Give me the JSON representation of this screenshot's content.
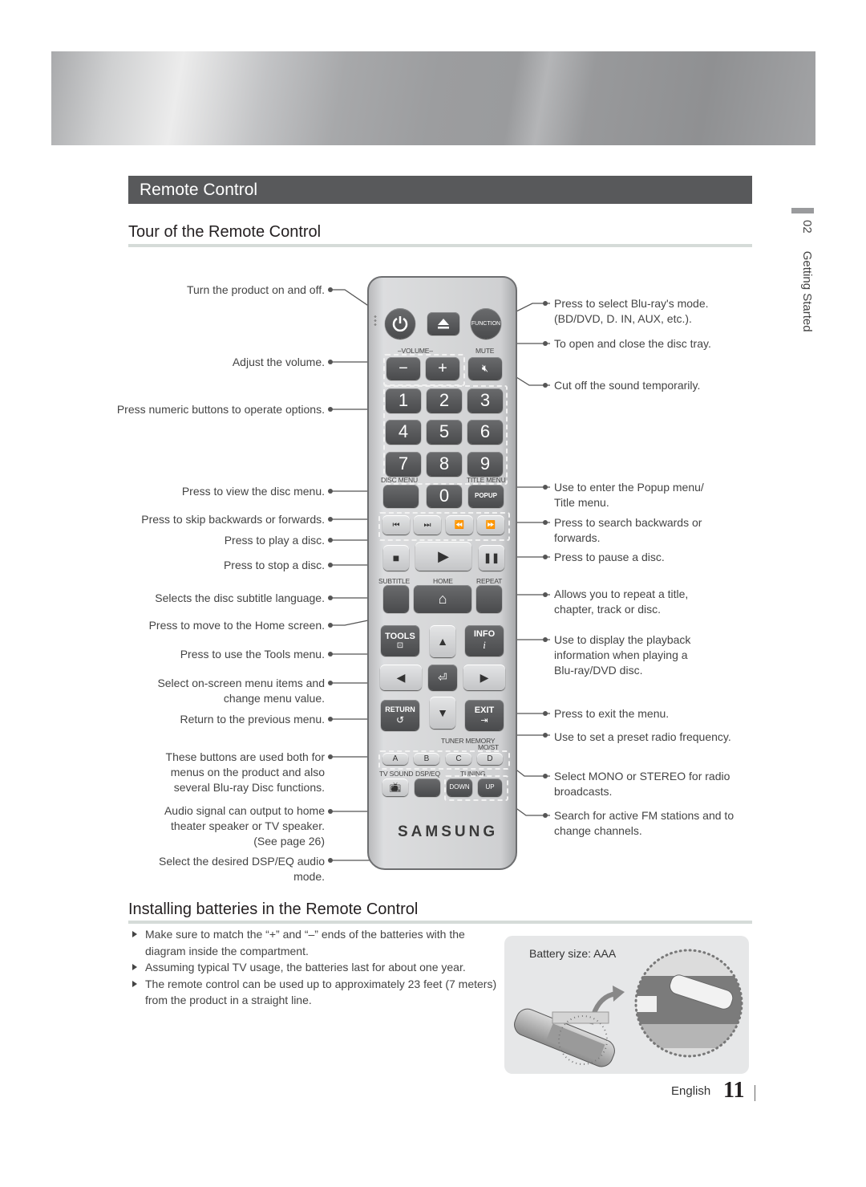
{
  "section_title": "Remote Control",
  "tour_heading": "Tour of the Remote Control",
  "side_tab": {
    "number": "02",
    "label": "Getting Started"
  },
  "left_callouts": [
    {
      "text": "Turn the product on and off."
    },
    {
      "text": "Adjust the volume."
    },
    {
      "text": "Press numeric buttons to operate options."
    },
    {
      "text": "Press to view the disc menu."
    },
    {
      "text": "Press to skip backwards or forwards."
    },
    {
      "text": "Press to play a disc."
    },
    {
      "text": "Press to stop a disc."
    },
    {
      "text": "Selects the disc subtitle language."
    },
    {
      "text": "Press to move to the Home screen."
    },
    {
      "text": "Press to use the Tools menu."
    },
    {
      "text": "Select on-screen menu items and change menu value."
    },
    {
      "text": "Return to the previous menu."
    },
    {
      "text": "These buttons are used both for menus on the product and also several Blu-ray Disc functions."
    },
    {
      "text": "Audio signal can output to home theater speaker or TV speaker. (See page 26)"
    },
    {
      "text": "Select the desired DSP/EQ audio mode."
    }
  ],
  "right_callouts": [
    {
      "text": "Press to select Blu-ray's mode. (BD/DVD, D. IN, AUX, etc.)."
    },
    {
      "text": "To open and close the disc tray."
    },
    {
      "text": "Cut off the sound temporarily."
    },
    {
      "text": "Use to enter the Popup menu/ Title menu."
    },
    {
      "text": "Press to search backwards or forwards."
    },
    {
      "text": "Press to pause a disc."
    },
    {
      "text": "Allows you to repeat a title, chapter, track or disc."
    },
    {
      "text": "Use to display the playback information when playing a Blu-ray/DVD disc."
    },
    {
      "text": "Press to exit the menu."
    },
    {
      "text": "Use to set a preset radio frequency."
    },
    {
      "text": "Select MONO or STEREO for radio broadcasts."
    },
    {
      "text": "Search for active FM stations and to change channels."
    }
  ],
  "remote": {
    "function": "FUNCTION",
    "volume_label": "VOLUME",
    "mute_label": "MUTE",
    "vol_minus": "−",
    "vol_plus": "+",
    "digits": [
      "1",
      "2",
      "3",
      "4",
      "5",
      "6",
      "7",
      "8",
      "9",
      "0"
    ],
    "disc_menu": "DISC MENU",
    "title_menu": "TITLE MENU",
    "popup": "POPUP",
    "subtitle": "SUBTITLE",
    "home": "HOME",
    "repeat": "REPEAT",
    "tools": "TOOLS",
    "info": "INFO",
    "info_glyph": "i",
    "return": "RETURN",
    "exit": "EXIT",
    "tuner_memory": "TUNER MEMORY",
    "mo_st": "MO/ST",
    "abcd": [
      "A",
      "B",
      "C",
      "D"
    ],
    "tv_sound": "TV SOUND",
    "dsp_eq": "DSP/EQ",
    "tuning": "TUNING",
    "down": "DOWN",
    "up": "UP",
    "brand": "SAMSUNG"
  },
  "batteries": {
    "heading": "Installing batteries in the Remote Control",
    "bullets": [
      "Make sure to match the “+” and “–” ends of the batteries with the diagram inside the compartment.",
      "Assuming typical TV usage, the batteries last for about one year.",
      "The remote control can be used up to approximately 23 feet (7 meters) from the product in a straight line."
    ],
    "battery_size": "Battery size: AAA"
  },
  "footer": {
    "language": "English",
    "page": "11"
  }
}
